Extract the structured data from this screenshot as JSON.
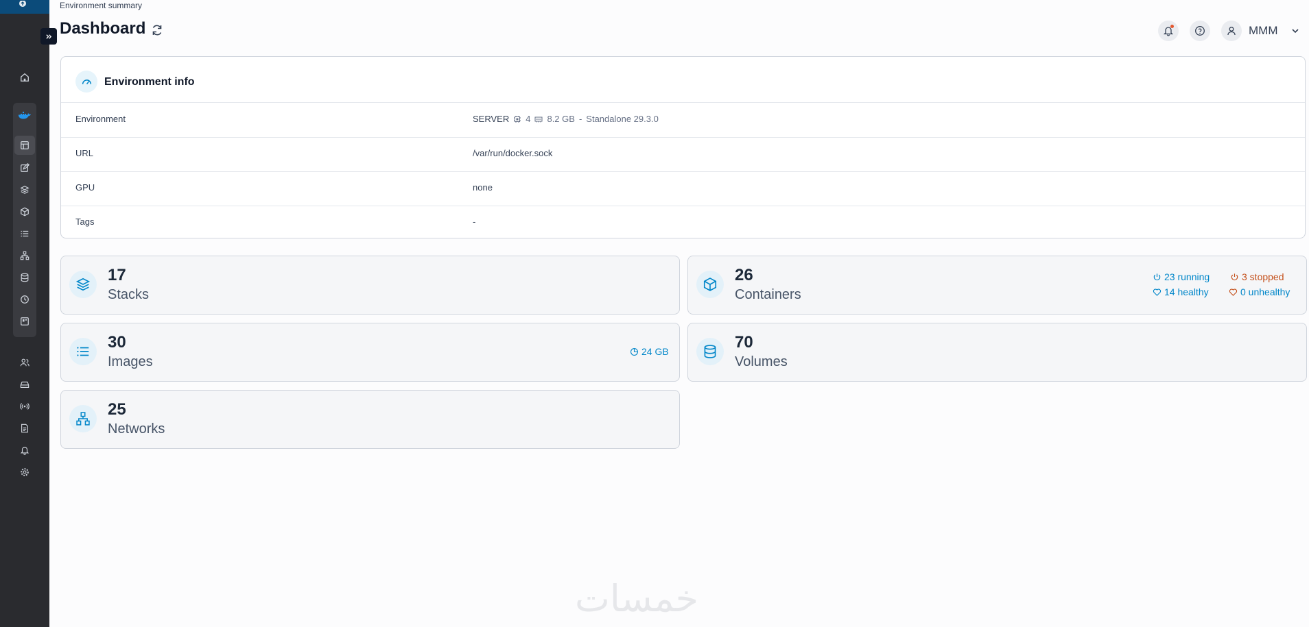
{
  "header": {
    "breadcrumb": "Environment summary",
    "title": "Dashboard",
    "user_name": "MMM"
  },
  "sidebar": {
    "icons": [
      "portainer-logo-icon",
      "expand-icon",
      "home-icon",
      "docker-icon",
      "dashboard-icon",
      "templates-icon",
      "stacks-icon",
      "containers-icon",
      "images-icon",
      "networks-icon",
      "volumes-icon",
      "events-icon",
      "host-icon",
      "users-icon",
      "environments-icon",
      "registries-icon",
      "logs-icon",
      "notifications-icon",
      "settings-icon"
    ]
  },
  "env_info": {
    "title": "Environment info",
    "rows": [
      {
        "key": "Environment",
        "name": "SERVER",
        "cpu": "4",
        "memory": "8.2 GB",
        "separator": "-",
        "mode": "Standalone 29.3.0"
      },
      {
        "key": "URL",
        "value": "/var/run/docker.sock"
      },
      {
        "key": "GPU",
        "value": "none"
      },
      {
        "key": "Tags",
        "value": "-"
      }
    ]
  },
  "stats": {
    "stacks": {
      "count": "17",
      "label": "Stacks"
    },
    "containers": {
      "count": "26",
      "label": "Containers",
      "running": "23 running",
      "stopped": "3 stopped",
      "healthy": "14 healthy",
      "unhealthy": "0 unhealthy"
    },
    "images": {
      "count": "30",
      "label": "Images",
      "size": "24 GB"
    },
    "volumes": {
      "count": "70",
      "label": "Volumes"
    },
    "networks": {
      "count": "25",
      "label": "Networks"
    }
  },
  "colors": {
    "sidebar_bg": "#2a2b2f",
    "accent": "#0086c9",
    "warning": "#c4501b"
  },
  "watermark": "خمسات"
}
